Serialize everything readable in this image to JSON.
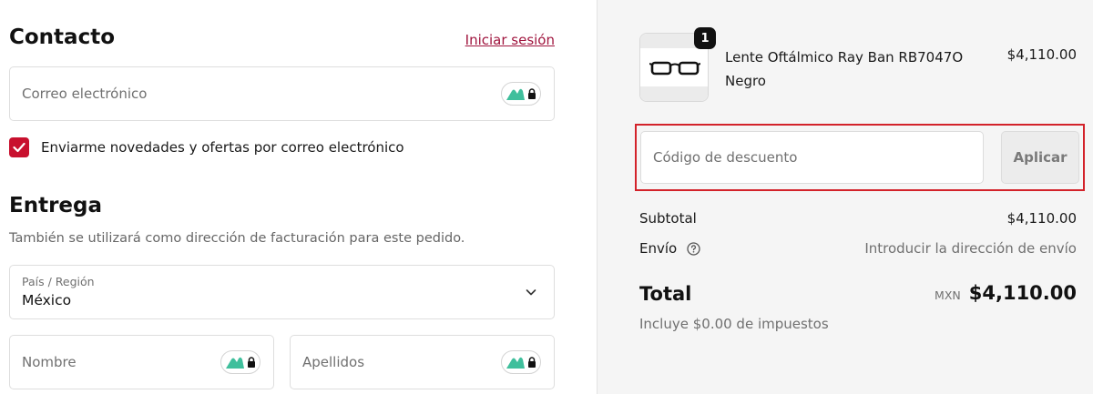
{
  "contact": {
    "title": "Contacto",
    "login_link": "Iniciar sesión",
    "email_placeholder": "Correo electrónico",
    "newsletter_label": "Enviarme novedades y ofertas por correo electrónico",
    "newsletter_checked": true
  },
  "delivery": {
    "title": "Entrega",
    "subtitle": "También se utilizará como dirección de facturación para este pedido.",
    "country_label": "País / Región",
    "country_value": "México",
    "first_name_placeholder": "Nombre",
    "last_name_placeholder": "Apellidos"
  },
  "summary": {
    "product": {
      "name": "Lente Oftálmico Ray Ban RB7047O",
      "variant": "Negro",
      "price": "$4,110.00",
      "quantity": "1",
      "image_icon": "eyeglasses-icon"
    },
    "discount": {
      "placeholder": "Código de descuento",
      "apply_label": "Aplicar"
    },
    "subtotal_label": "Subtotal",
    "subtotal_value": "$4,110.00",
    "shipping_label": "Envío",
    "shipping_value": "Introducir la dirección de envío",
    "total_label": "Total",
    "currency": "MXN",
    "total_value": "$4,110.00",
    "taxes_note": "Incluye $0.00 de impuestos"
  },
  "colors": {
    "accent": "#c8102e",
    "link": "#a0153e",
    "highlight_border": "#d3222a",
    "summary_bg": "#f5f5f5"
  }
}
